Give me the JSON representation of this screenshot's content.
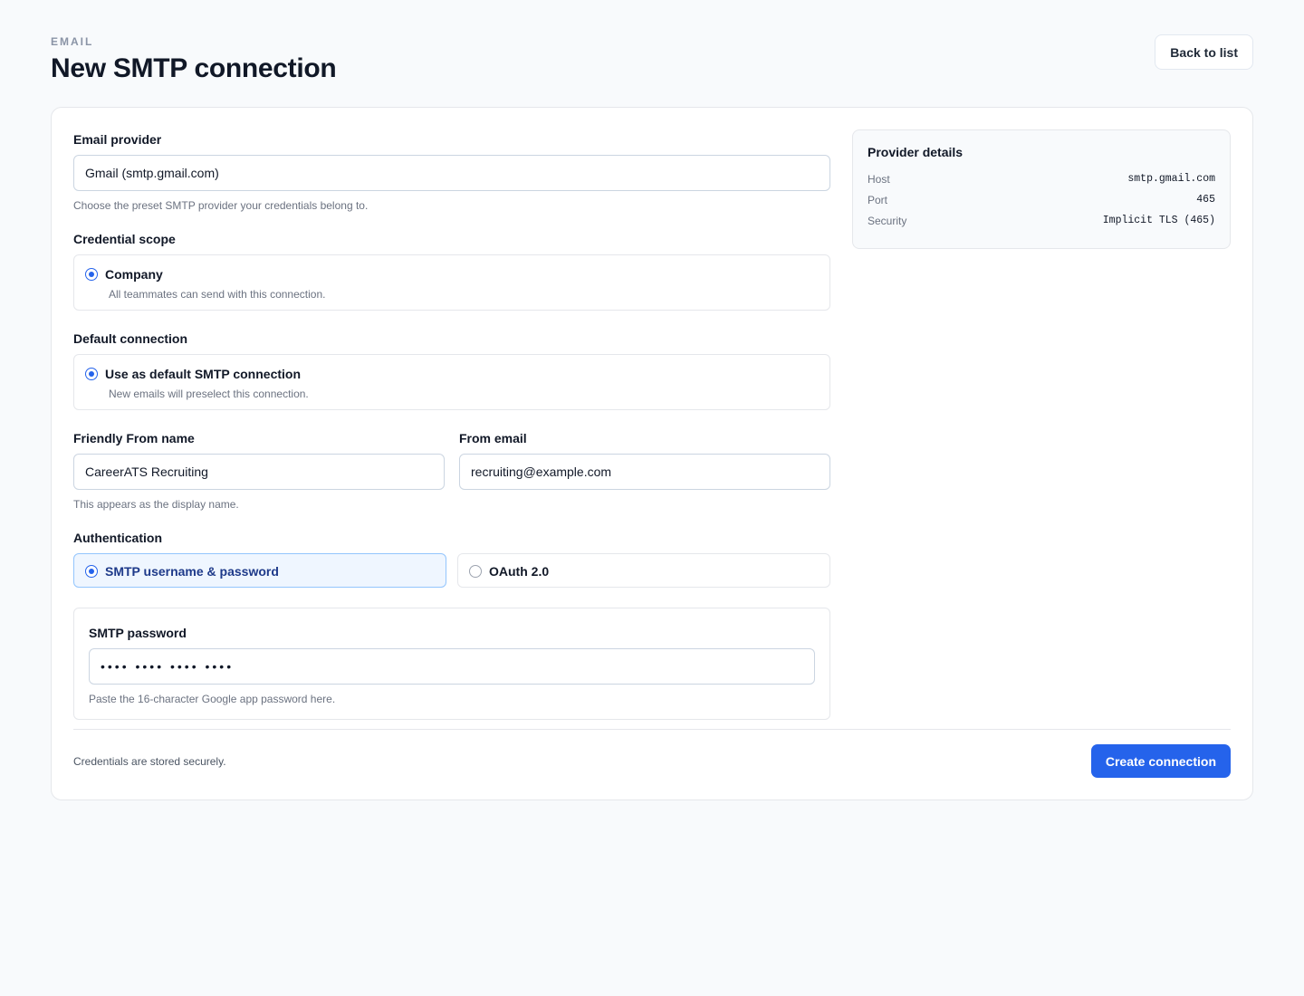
{
  "header": {
    "eyebrow": "EMAIL",
    "title": "New SMTP connection",
    "back_label": "Back to list"
  },
  "form": {
    "provider": {
      "label": "Email provider",
      "value": "Gmail (smtp.gmail.com)",
      "help": "Choose the preset SMTP provider your credentials belong to."
    },
    "scope": {
      "label": "Credential scope",
      "option_title": "Company",
      "option_sub": "All teammates can send with this connection."
    },
    "default_conn": {
      "label": "Default connection",
      "option_title": "Use as default SMTP connection",
      "option_sub": "New emails will preselect this connection."
    },
    "from_name": {
      "label": "Friendly From name",
      "value": "CareerATS Recruiting",
      "help": "This appears as the display name."
    },
    "from_email": {
      "label": "From email",
      "value": "recruiting@example.com"
    },
    "auth": {
      "label": "Authentication",
      "options": [
        {
          "label": "SMTP username & password",
          "selected": true
        },
        {
          "label": "OAuth 2.0",
          "selected": false
        }
      ]
    },
    "password": {
      "label": "SMTP password",
      "value": "•••• •••• •••• ••••",
      "help": "Paste the 16-character Google app password here."
    }
  },
  "provider_details": {
    "title": "Provider details",
    "rows": [
      {
        "key": "Host",
        "value": "smtp.gmail.com"
      },
      {
        "key": "Port",
        "value": "465"
      },
      {
        "key": "Security",
        "value": "Implicit TLS (465)"
      }
    ]
  },
  "footer": {
    "note": "Credentials are stored securely.",
    "submit_label": "Create connection"
  },
  "colors": {
    "accent": "#2563eb",
    "background": "#f8fafc"
  }
}
